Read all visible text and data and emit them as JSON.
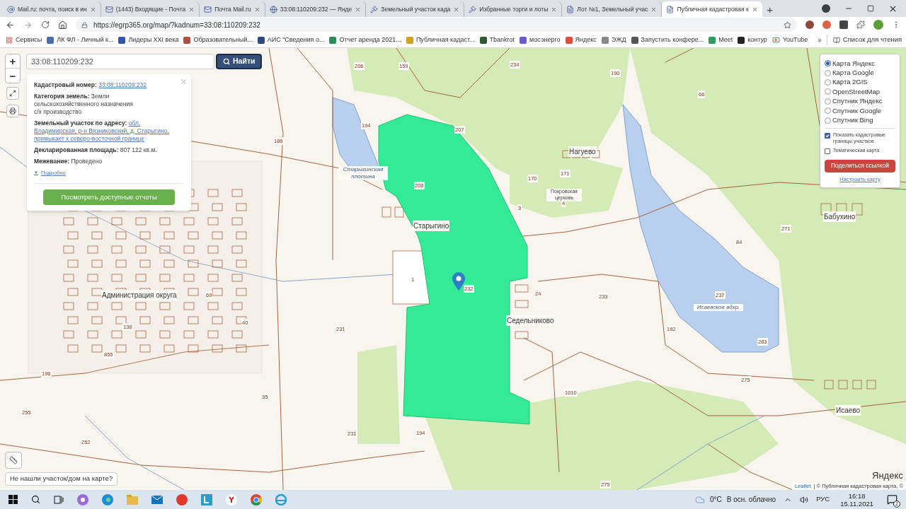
{
  "browser": {
    "tabs": [
      {
        "title": "Mail.ru: почта, поиск в ин",
        "selected": false
      },
      {
        "title": "(1443) Входящие - Почта",
        "selected": false
      },
      {
        "title": "Почта Mail.ru",
        "selected": false
      },
      {
        "title": "33:08:110209:232 — Янде",
        "selected": false
      },
      {
        "title": "Земельный участок када",
        "selected": false
      },
      {
        "title": "Избранные торги и лоты",
        "selected": false
      },
      {
        "title": "Лот №1, Земельный учас",
        "selected": false
      },
      {
        "title": "Публичная кадастровая к",
        "selected": true
      }
    ],
    "new_tab": "+",
    "address": "https://egrp365.org/map/?kadnum=33:08:110209:232",
    "bookmarks": [
      "Сервисы",
      "ЛК ФЛ - Личный к...",
      "Лидеры XXI века",
      "Образовательный...",
      "АИС \"Сведения о...",
      "Отчет аренда 2021...",
      "Публичная кадаст...",
      "Tbankrot",
      "мосэнерго",
      "Яндекс",
      "ЭЖД",
      "Запустить конфере...",
      "Meet",
      "контур",
      "YouTube"
    ],
    "bookmarks_more": "»",
    "reading_list": "Список для чтения"
  },
  "map": {
    "search": {
      "value": "33:08:110209:232",
      "button": "Найти"
    },
    "zoom_in": "+",
    "zoom_out": "−",
    "popup": {
      "fields": [
        {
          "label": "Кадастровый номер:",
          "value": "33:08:110209:232",
          "kind": "link"
        },
        {
          "label": "Категория земель:",
          "value": "Земли сельскохозяйственного назначения",
          "extra": "с/х производство",
          "kind": "text"
        },
        {
          "label": "Земельный участок по адресу:",
          "value": "обл. Владимирская, р-н Вязниковский, д. Старыгино, примыкает к северо-восточной границе",
          "kind": "link"
        },
        {
          "label": "Декларированная площадь:",
          "value": "807 122 кв.м.",
          "kind": "text"
        },
        {
          "label": "Межевание:",
          "value": "Проведено",
          "kind": "text"
        }
      ],
      "details_marker": "▼",
      "details": "Подробно",
      "report_button": "Посмотреть доступные отчеты"
    },
    "layers": [
      {
        "label": "Карта Яндекс",
        "selected": true
      },
      {
        "label": "Карта Google",
        "selected": false
      },
      {
        "label": "Карта 2GIS",
        "selected": false
      },
      {
        "label": "OpenStreetMap",
        "selected": false
      },
      {
        "label": "Спутник Яндекс",
        "selected": false
      },
      {
        "label": "Спутник Google",
        "selected": false
      },
      {
        "label": "Спутник Bing",
        "selected": false
      }
    ],
    "options": [
      {
        "label": "Показать кадастровые границы участков",
        "checked": true
      },
      {
        "label": "Тематическая карта",
        "checked": false
      }
    ],
    "share_button": "Поделиться ссылкой",
    "configure_link": "Настроить карту",
    "labels": [
      {
        "text": "Старыгинская плотина",
        "kind": "water"
      },
      {
        "text": "Нагуево",
        "kind": "place"
      },
      {
        "text": "Покровская церковь",
        "kind": "small"
      },
      {
        "text": "Старыгино",
        "kind": "place"
      },
      {
        "text": "Седельниково",
        "kind": "place"
      },
      {
        "text": "Бабухино",
        "kind": "place"
      },
      {
        "text": "Исаевское вдхр.",
        "kind": "water"
      },
      {
        "text": "Исаево",
        "kind": "place"
      },
      {
        "text": "Администрация округа",
        "kind": "place"
      },
      {
        "text": "206",
        "kind": "number"
      },
      {
        "text": "159",
        "kind": "number"
      },
      {
        "text": "234",
        "kind": "number"
      },
      {
        "text": "190",
        "kind": "number"
      },
      {
        "text": "66",
        "kind": "number"
      },
      {
        "text": "194",
        "kind": "number"
      },
      {
        "text": "207",
        "kind": "number"
      },
      {
        "text": "186",
        "kind": "number"
      },
      {
        "text": "208",
        "kind": "number"
      },
      {
        "text": "170",
        "kind": "number"
      },
      {
        "text": "171",
        "kind": "number"
      },
      {
        "text": "3",
        "kind": "number"
      },
      {
        "text": "4",
        "kind": "number"
      },
      {
        "text": "271",
        "kind": "number"
      },
      {
        "text": "84",
        "kind": "number"
      },
      {
        "text": "1",
        "kind": "number"
      },
      {
        "text": "232",
        "kind": "number"
      },
      {
        "text": "24",
        "kind": "number"
      },
      {
        "text": "233",
        "kind": "number"
      },
      {
        "text": "237",
        "kind": "number"
      },
      {
        "text": "192",
        "kind": "number"
      },
      {
        "text": "283",
        "kind": "number"
      },
      {
        "text": "231",
        "kind": "number"
      },
      {
        "text": "138",
        "kind": "number"
      },
      {
        "text": "40",
        "kind": "number"
      },
      {
        "text": "855",
        "kind": "number"
      },
      {
        "text": "196",
        "kind": "number"
      },
      {
        "text": "35",
        "kind": "number"
      },
      {
        "text": "1010",
        "kind": "number"
      },
      {
        "text": "231",
        "kind": "number"
      },
      {
        "text": "194",
        "kind": "number"
      },
      {
        "text": "275",
        "kind": "number"
      },
      {
        "text": "252",
        "kind": "number"
      },
      {
        "text": "255",
        "kind": "number"
      },
      {
        "text": "275",
        "kind": "number"
      },
      {
        "text": "69",
        "kind": "number"
      }
    ],
    "not_found_button": "Не нашли участок/дом на карте?",
    "logo": "Яндекс",
    "attribution": {
      "link": "Leaflet",
      "text": "| © Публичная кадастровая карта, ©"
    }
  },
  "taskbar": {
    "temperature": "0°C",
    "weather": "В осн. облачно",
    "language": "РУС",
    "time": "16:18",
    "date": "15.11.2021",
    "notifications": "2"
  }
}
